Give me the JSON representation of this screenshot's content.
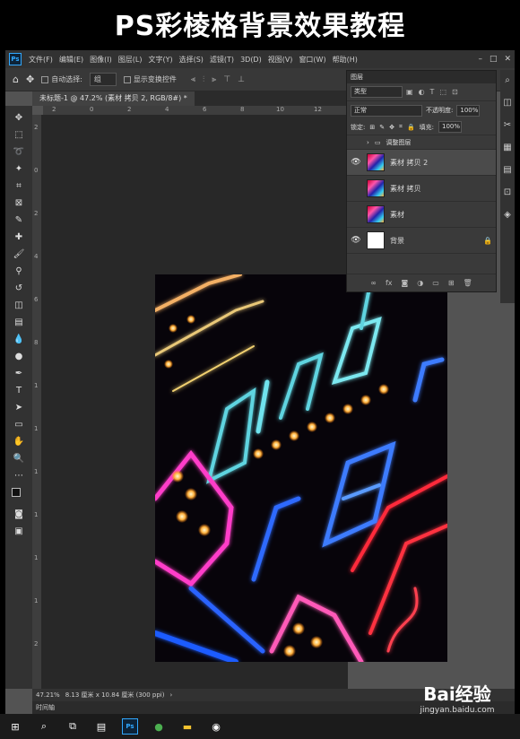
{
  "banner": {
    "title": "PS彩棱格背景效果教程"
  },
  "menubar": {
    "logo": "Ps",
    "items": [
      "文件(F)",
      "编辑(E)",
      "图像(I)",
      "图层(L)",
      "文字(Y)",
      "选择(S)",
      "滤镜(T)",
      "3D(D)",
      "视图(V)",
      "窗口(W)",
      "帮助(H)"
    ]
  },
  "optionsbar": {
    "auto_select_label": "自动选择:",
    "auto_select_value": "组",
    "show_transform_label": "显示变换控件"
  },
  "document": {
    "tab_label": "未标题-1 @ 47.2% (素材 拷贝 2, RGB/8#) *"
  },
  "ruler": {
    "h_ticks": [
      "2",
      "0",
      "2",
      "4",
      "6",
      "8",
      "10",
      "12"
    ],
    "v_ticks": [
      "2",
      "0",
      "2",
      "4",
      "6",
      "8",
      "1",
      "1",
      "1",
      "1",
      "1",
      "1",
      "2"
    ]
  },
  "layers_panel": {
    "title": "图层",
    "search_label": "类型",
    "blend_mode": "正常",
    "opacity_label": "不透明度:",
    "opacity_value": "100%",
    "lock_label": "锁定:",
    "fill_label": "填充:",
    "fill_value": "100%",
    "group_name": "调整图层",
    "layers": [
      {
        "name": "素材 拷贝 2",
        "visible": true,
        "selected": true,
        "thumb": "image"
      },
      {
        "name": "素材 拷贝",
        "visible": false,
        "selected": false,
        "thumb": "image"
      },
      {
        "name": "素材",
        "visible": false,
        "selected": false,
        "thumb": "image"
      },
      {
        "name": "背景",
        "visible": true,
        "selected": false,
        "thumb": "white",
        "locked": true
      }
    ],
    "footer_icons": [
      "link-icon",
      "fx-icon",
      "mask-icon",
      "adjustment-icon",
      "folder-icon",
      "new-layer-icon",
      "trash-icon"
    ]
  },
  "status": {
    "zoom": "47.21%",
    "doc_size": "8.13 厘米 x 10.84 厘米 (300 ppi)",
    "timeline_label": "时间轴"
  },
  "watermark": {
    "main": "Bai经验",
    "sub": "jingyan.baidu.com"
  },
  "taskbar": {
    "items": [
      "windows-icon",
      "search-icon",
      "taskview-icon",
      "document-icon",
      "photoshop-icon",
      "green-app-icon",
      "folder-icon",
      "camera-icon"
    ]
  },
  "colors": {
    "accent_ps": "#31a8ff",
    "panel_bg": "#3a3a3a",
    "canvas_bg": "#282828"
  }
}
